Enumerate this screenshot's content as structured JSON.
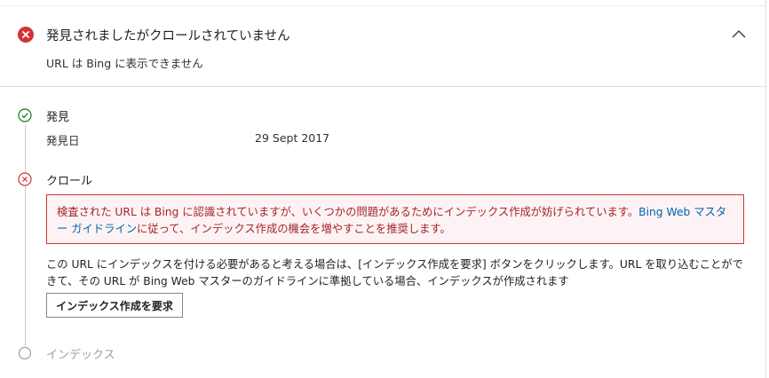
{
  "header": {
    "title": "発見されましたがクロールされていません",
    "subtitle": "URL は Bing に表示できません",
    "status_icon": "error-circle-icon",
    "collapse_icon": "chevron-up-icon"
  },
  "steps": [
    {
      "title": "発見",
      "icon": "check-circle-icon",
      "status": "success",
      "detail_label": "発見日",
      "detail_value": "29 Sept 2017"
    },
    {
      "title": "クロール",
      "icon": "error-circle-outline-icon",
      "status": "error",
      "alert_text": "検査された URL は Bing に認識されていますが、いくつかの問題があるためにインデックス作成が妨げられています。",
      "alert_link": "Bing Web マスター ガイドライン",
      "alert_text_after": "に従って、インデックス作成の機会を増やすことを推奨します。",
      "description": "この URL にインデックスを付ける必要があると考える場合は、[インデックス作成を要求] ボタンをクリックします。URL を取り込むことができて、その URL が Bing Web マスターのガイドラインに準拠している場合、インデックスが作成されます",
      "button_label": "インデックス作成を要求"
    },
    {
      "title": "インデックス",
      "icon": "empty-circle-icon",
      "status": "pending"
    }
  ],
  "colors": {
    "error": "#d13438",
    "success": "#107c10",
    "link": "#0062ad",
    "pending": "#a19f9d"
  }
}
